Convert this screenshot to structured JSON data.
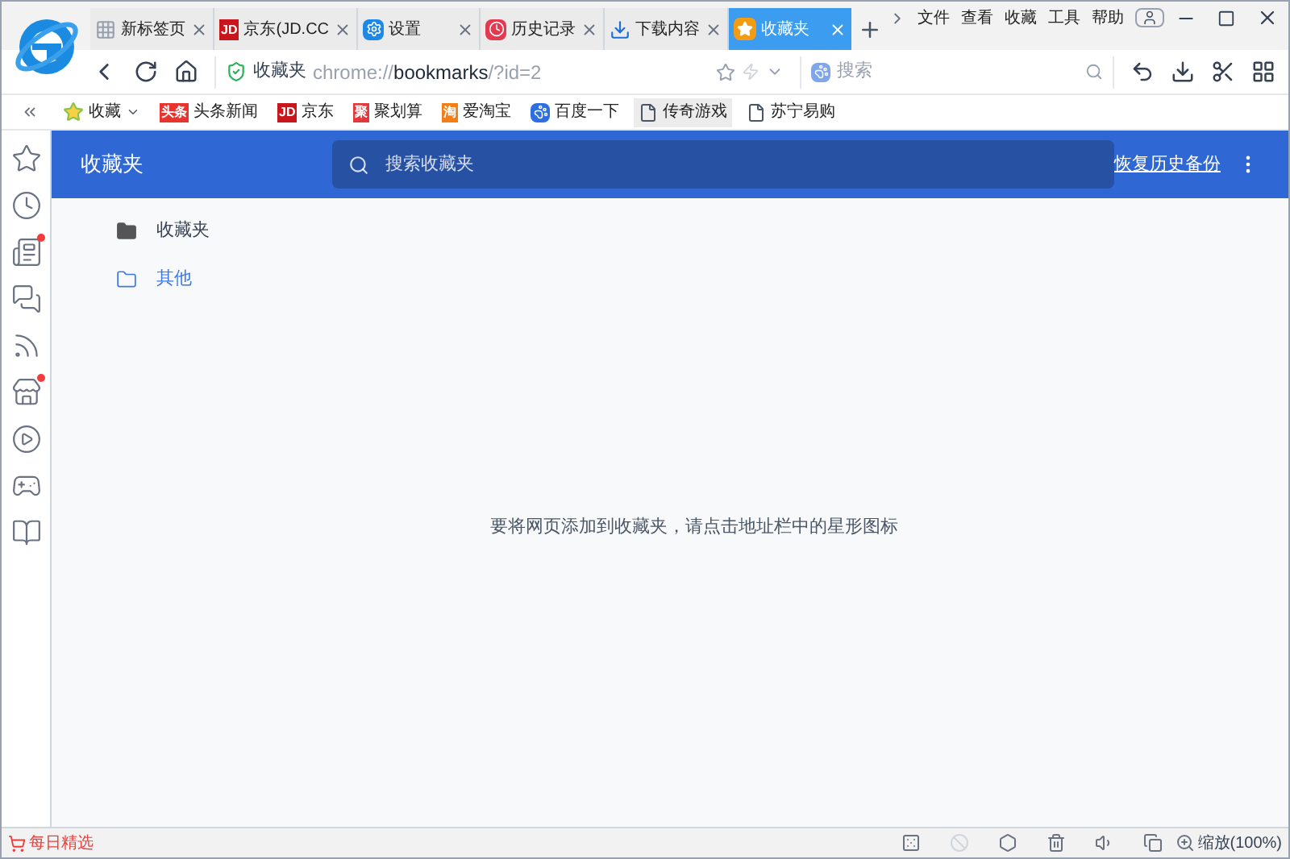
{
  "tabs": [
    {
      "label": "新标签页",
      "kind": "grid",
      "selected": false
    },
    {
      "label": "京东(JD.CC",
      "kind": "badge",
      "badge": "JD",
      "selected": false
    },
    {
      "label": "设置",
      "kind": "gear",
      "selected": false
    },
    {
      "label": "历史记录",
      "kind": "clock",
      "selected": false
    },
    {
      "label": "下载内容",
      "kind": "download",
      "selected": false
    },
    {
      "label": "收藏夹",
      "kind": "star",
      "selected": true
    }
  ],
  "menu": [
    "文件",
    "查看",
    "收藏",
    "工具",
    "帮助"
  ],
  "address": {
    "site_label": "收藏夹",
    "url_scheme": "chrome://",
    "url_host": "bookmarks",
    "url_path": "/?id=2",
    "search_placeholder": "搜索"
  },
  "bookmarks_bar": [
    {
      "label": "收藏",
      "kind": "menu"
    },
    {
      "label": "头条新闻",
      "kind": "badge",
      "badge": "头条",
      "color": "#e8332f"
    },
    {
      "label": "京东",
      "kind": "badge",
      "badge": "JD",
      "color": "#c8161d"
    },
    {
      "label": "聚划算",
      "kind": "badge",
      "badge": "聚",
      "color": "#e4393c"
    },
    {
      "label": "爱淘宝",
      "kind": "badge",
      "badge": "淘",
      "color": "#f57d16"
    },
    {
      "label": "百度一下",
      "kind": "paw"
    },
    {
      "label": "传奇游戏",
      "kind": "page",
      "hovered": true
    },
    {
      "label": "苏宁易购",
      "kind": "page",
      "hovered": false
    }
  ],
  "sidebar": [
    {
      "kind": "star",
      "notification": false
    },
    {
      "kind": "clock",
      "notification": false
    },
    {
      "kind": "news",
      "notification": true
    },
    {
      "kind": "chat",
      "notification": false
    },
    {
      "kind": "weibo",
      "notification": false
    },
    {
      "kind": "shop",
      "notification": true
    },
    {
      "kind": "play",
      "notification": false
    },
    {
      "kind": "game",
      "notification": false
    },
    {
      "kind": "reader",
      "notification": false
    }
  ],
  "header": {
    "title": "收藏夹",
    "search_placeholder": "搜索收藏夹",
    "restore_link": "恢复历史备份"
  },
  "folders": [
    {
      "label": "收藏夹",
      "selected": false
    },
    {
      "label": "其他",
      "selected": true
    }
  ],
  "empty_message": "要将网页添加到收藏夹，请点击地址栏中的星形图标",
  "status_bar": {
    "daily_picks": "每日精选",
    "zoom": "缩放(100%)"
  }
}
